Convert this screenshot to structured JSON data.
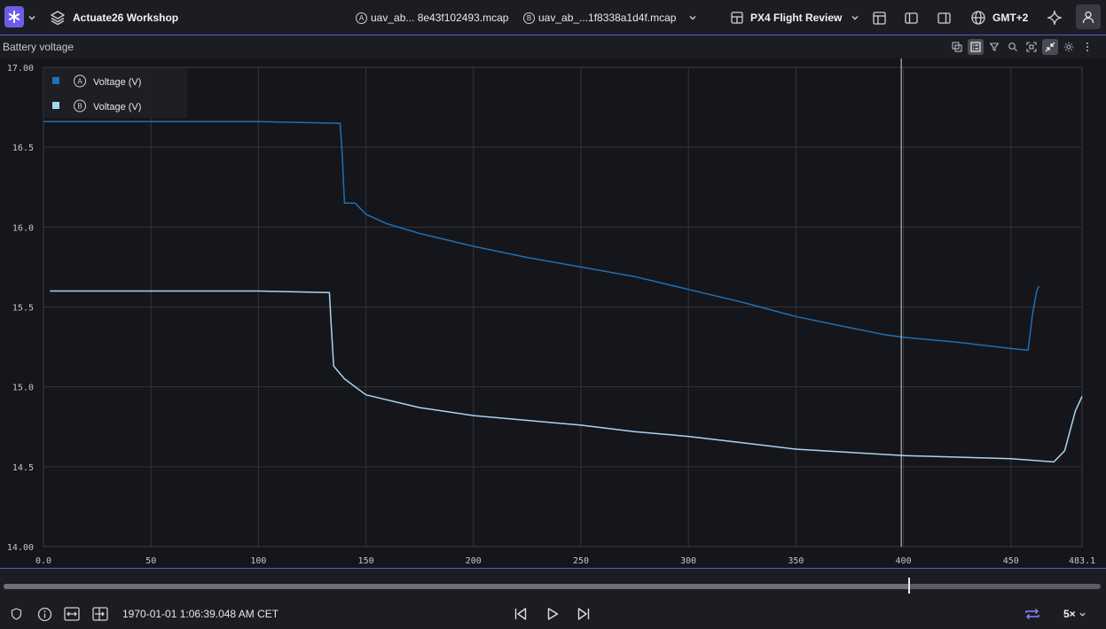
{
  "topbar": {
    "workspace_title": "Actuate26 Workshop",
    "file_a_label": "A",
    "file_a_name": "uav_ab... 8e43f102493.mcap",
    "file_b_label": "B",
    "file_b_name": "uav_ab_...1f8338a1d4f.mcap",
    "layout_name": "PX4 Flight Review",
    "timezone": "GMT+2"
  },
  "panel": {
    "title": "Battery voltage"
  },
  "legend": [
    {
      "badge": "A",
      "label": "Voltage (V)",
      "color": "#1f6fb5"
    },
    {
      "badge": "B",
      "label": "Voltage (V)",
      "color": "#a9d4f5"
    }
  ],
  "chart_data": {
    "type": "line",
    "title": "Battery voltage",
    "xlim": [
      0,
      483.1
    ],
    "ylim": [
      14.0,
      17.0
    ],
    "x_ticks": [
      "0.0",
      "50",
      "100",
      "150",
      "200",
      "250",
      "300",
      "350",
      "400",
      "450",
      "483.1"
    ],
    "y_ticks": [
      "14.00",
      "14.5",
      "15.0",
      "15.5",
      "16.0",
      "16.5",
      "17.00"
    ],
    "grid": true,
    "legend_position": "top-left",
    "cursor_x": 399,
    "series": [
      {
        "name": "Voltage (V)",
        "color": "#1f6fb5",
        "x": [
          0,
          50,
          100,
          138,
          139,
          140,
          145,
          150,
          160,
          175,
          200,
          225,
          250,
          275,
          300,
          325,
          350,
          375,
          390,
          400,
          425,
          450,
          458,
          460,
          462,
          463
        ],
        "values": [
          16.66,
          16.66,
          16.66,
          16.65,
          16.45,
          16.15,
          16.15,
          16.08,
          16.02,
          15.96,
          15.88,
          15.81,
          15.75,
          15.69,
          15.61,
          15.53,
          15.44,
          15.37,
          15.33,
          15.31,
          15.28,
          15.24,
          15.23,
          15.45,
          15.6,
          15.63
        ]
      },
      {
        "name": "Voltage (V)",
        "color": "#a9d4f5",
        "x": [
          3,
          50,
          100,
          133,
          134,
          135,
          140,
          150,
          175,
          200,
          225,
          250,
          275,
          300,
          325,
          350,
          375,
          400,
          425,
          450,
          470,
          475,
          480,
          483.1
        ],
        "values": [
          15.6,
          15.6,
          15.6,
          15.59,
          15.35,
          15.13,
          15.05,
          14.95,
          14.87,
          14.82,
          14.79,
          14.76,
          14.72,
          14.69,
          14.65,
          14.61,
          14.59,
          14.57,
          14.56,
          14.55,
          14.53,
          14.6,
          14.85,
          14.94
        ]
      }
    ]
  },
  "playback": {
    "progress": 0.825,
    "current_time": "1970-01-01 1:06:39.048 AM CET",
    "speed": "5×"
  }
}
